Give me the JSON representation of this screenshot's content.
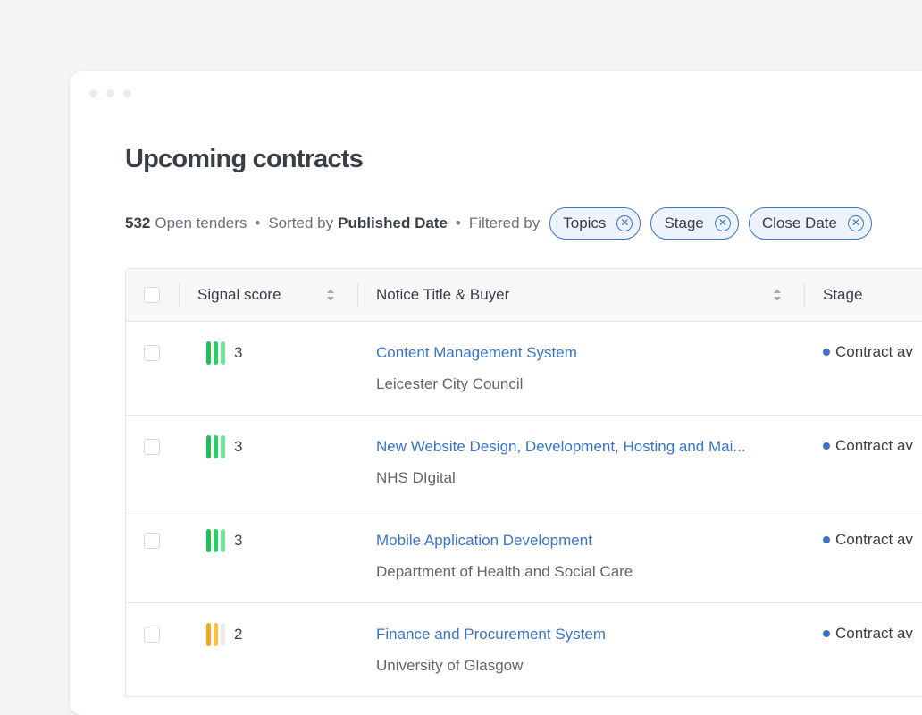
{
  "page": {
    "title": "Upcoming contracts",
    "summary": {
      "count": "532",
      "count_label": "Open tenders",
      "sorted_by_label": "Sorted by",
      "sorted_by_value": "Published Date",
      "filtered_by_label": "Filtered by",
      "separator": "•"
    },
    "filters": [
      {
        "label": "Topics"
      },
      {
        "label": "Stage"
      },
      {
        "label": "Close Date"
      }
    ]
  },
  "table": {
    "headers": {
      "signal_score": "Signal score",
      "notice_title_buyer": "Notice Title & Buyer",
      "stage": "Stage"
    },
    "rows": [
      {
        "score": "3",
        "signal_level": 3,
        "title": "Content Management System",
        "buyer": "Leicester City Council",
        "stage": "Contract av"
      },
      {
        "score": "3",
        "signal_level": 3,
        "title": "New Website Design, Development, Hosting and Mai...",
        "buyer": "NHS DIgital",
        "stage": "Contract av"
      },
      {
        "score": "3",
        "signal_level": 3,
        "title": "Mobile Application Development",
        "buyer": "Department of Health and Social Care",
        "stage": "Contract av"
      },
      {
        "score": "2",
        "signal_level": 2,
        "title": "Finance and Procurement System",
        "buyer": "University of Glasgow",
        "stage": "Contract av"
      }
    ]
  },
  "colors": {
    "accent": "#3a74c7",
    "signal_high": [
      "#1fbf5a",
      "#2ccc65",
      "#6fe49a"
    ],
    "signal_mid": [
      "#f5a524",
      "#f8c240",
      "#ececec"
    ]
  }
}
